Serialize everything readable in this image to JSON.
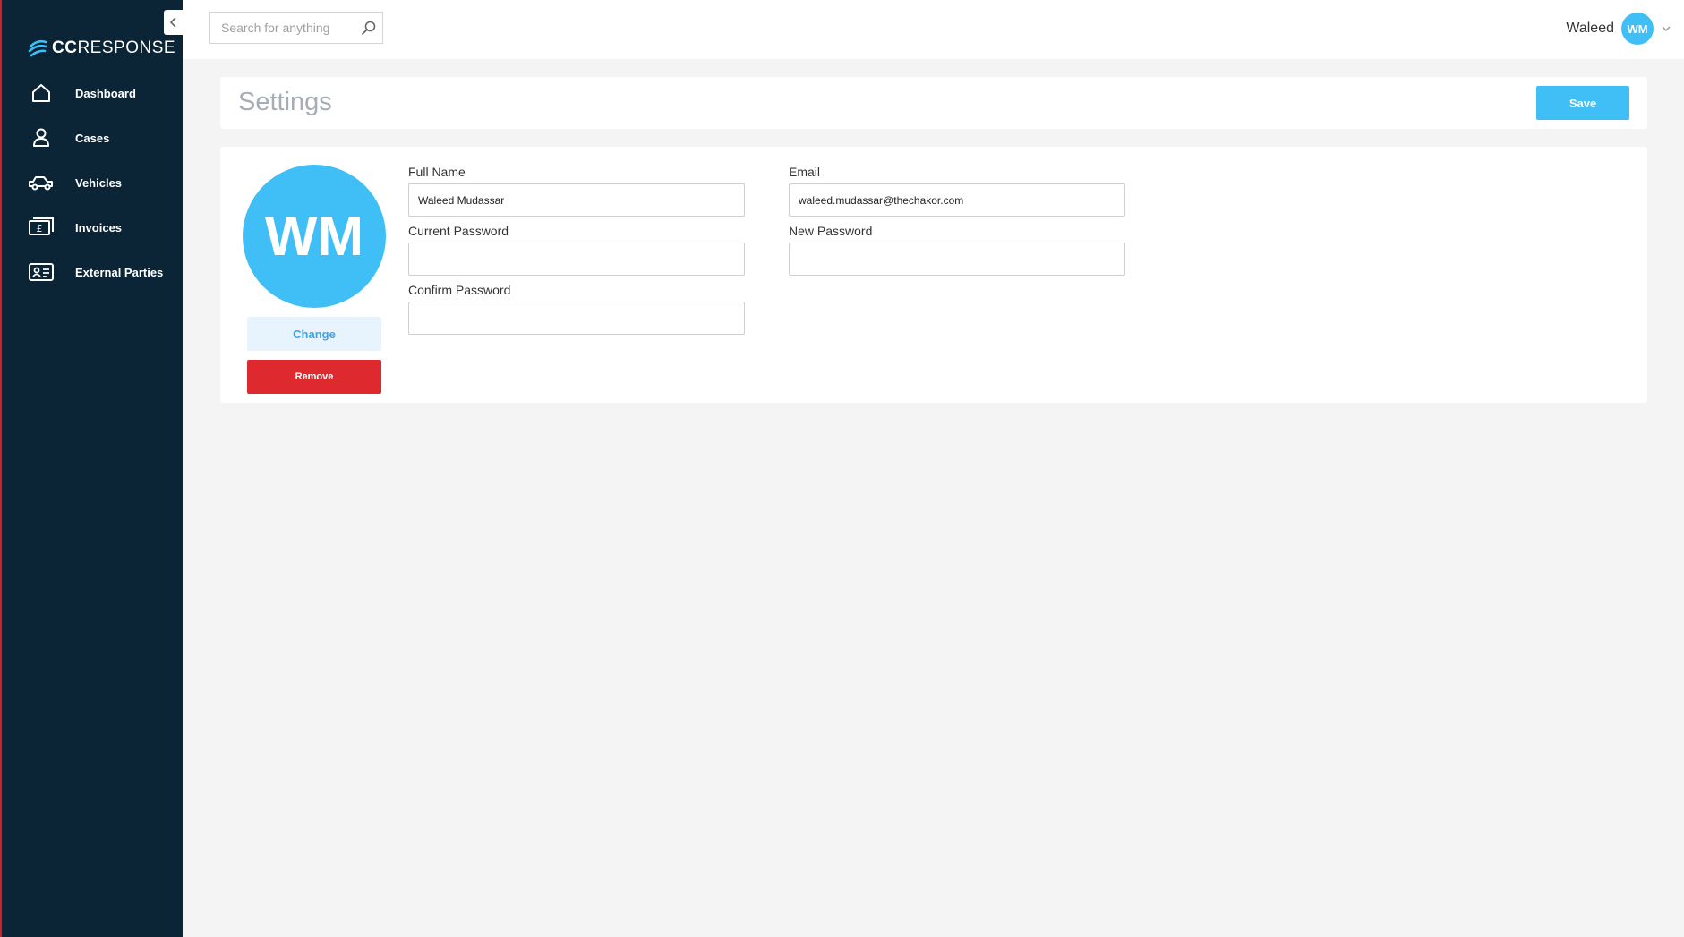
{
  "sidebar": {
    "logo": {
      "prefix": "CC",
      "suffix": "RESPONSE"
    },
    "items": [
      {
        "label": "Dashboard",
        "icon": "home-icon"
      },
      {
        "label": "Cases",
        "icon": "person-icon"
      },
      {
        "label": "Vehicles",
        "icon": "vehicle-icon"
      },
      {
        "label": "Invoices",
        "icon": "invoice-icon"
      },
      {
        "label": "External Parties",
        "icon": "id-card-icon"
      }
    ]
  },
  "topbar": {
    "search_placeholder": "Search for anything",
    "user_name": "Waleed",
    "user_initials": "WM"
  },
  "page": {
    "title": "Settings",
    "save_label": "Save"
  },
  "profile": {
    "initials": "WM",
    "change_label": "Change",
    "remove_label": "Remove",
    "fields": {
      "full_name": {
        "label": "Full Name",
        "value": "Waleed Mudassar"
      },
      "email": {
        "label": "Email",
        "value": "waleed.mudassar@thechakor.com"
      },
      "current_password": {
        "label": "Current Password",
        "value": ""
      },
      "new_password": {
        "label": "New Password",
        "value": ""
      },
      "confirm_password": {
        "label": "Confirm Password",
        "value": ""
      }
    }
  },
  "colors": {
    "sidebar_bg": "#0b2436",
    "accent": "#3fbff5",
    "danger": "#de2a2e",
    "page_bg": "#f4f4f4"
  }
}
